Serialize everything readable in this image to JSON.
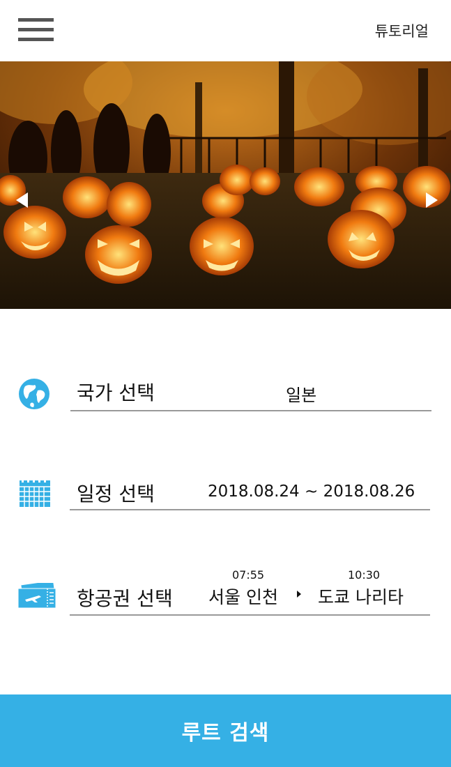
{
  "header": {
    "tutorial_label": "튜토리얼"
  },
  "colors": {
    "accent": "#35b0e5",
    "divider": "#999999"
  },
  "icons": {
    "menu": "hamburger-menu-icon",
    "country": "globe-icon",
    "schedule": "calendar-icon",
    "ticket": "airplane-ticket-icon"
  },
  "country": {
    "label": "국가 선택",
    "value": "일본"
  },
  "schedule": {
    "label": "일정 선택",
    "value": "2018.08.24 ~ 2018.08.26"
  },
  "flight": {
    "label": "항공권 선택",
    "from_time": "07:55",
    "from": "서울 인천",
    "to_time": "10:30",
    "to": "도쿄 나리타"
  },
  "search_button": "루트 검색"
}
